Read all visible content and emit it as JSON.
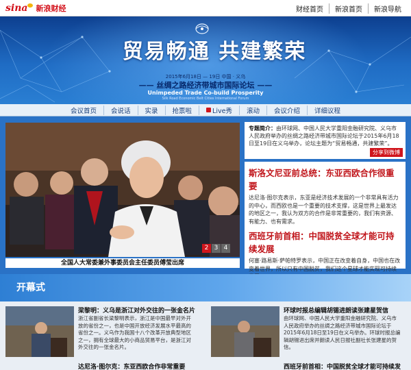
{
  "topbar": {
    "logo_sina": "sina",
    "logo_finance": "新浪财经",
    "links": [
      "财经首页",
      "新浪首页",
      "新浪导航"
    ]
  },
  "banner": {
    "title": "贸易畅通 共建繁荣",
    "date": "2015年6月18日 — 19日  中国 · 义乌",
    "forum_cn": "—— 丝绸之路经济带城市国际论坛 ——",
    "en_line1": "Unimpeded Trade  Co-build Prosperity",
    "en_line2": "Silk Road Economic Belt Cities International Forum"
  },
  "nav": {
    "items": [
      "会议首页",
      "会说话",
      "实录",
      "抢票啦",
      "Live秀",
      "滚动",
      "会议介绍",
      "详细议程"
    ]
  },
  "feature": {
    "caption": "全国人大常委兼外事委员会主任委员傅莹出席",
    "pages": [
      "2",
      "3",
      "4"
    ]
  },
  "intro": {
    "label": "专题简介：",
    "text": "由环球网、中国人民大学重阳金融研究院、义乌市人民政府举办的丝绸之路经济带城市国际论坛于2015年6月18日至19日在义乌举办，论坛主题为“贸易畅通，共建繁荣”。",
    "share": "分享到微博"
  },
  "news": [
    {
      "title": "斯洛文尼亚前总统：东亚西欧合作很重要",
      "text": "达尼洛·图尔克表示，东亚是经济技术发展的一个非常具有活力的中心，而西欧也是一个重要的技术支撑，这是世界上最发达的地区之一，我认为双方的合作是非常重要的，我们有资源、有能力、也有需求。"
    },
    {
      "title": "西班牙前首相：中国脱贫全球才能可持续发展",
      "text": "何塞·路易斯·萨帕特罗表示，中国正在改变着自身，中国也在改变着世界，所以只有中国脱贫，我们这个星球才能实现可持续发展。"
    }
  ],
  "section": {
    "title": "开幕式"
  },
  "cards": [
    {
      "title": "梁黎明：义乌是浙江对外交往的一张金名片",
      "text": "浙江省副省长梁黎明表示，浙江是中国最早对外开放的省份之一，也是中国开放经济发展水平最高的省份之一。义乌作为我国十八个改革开放典型地区之一，拥有全球最大的小商品贸易平台，是浙江对外交往的一张金名片。",
      "more": "达尼洛·图尔克：东亚西欧合作非常重要"
    },
    {
      "title": "环球时报总编辑胡锡进朗读张建星贺信",
      "text": "由环球网、中国人民大学重阳金融研究院、义乌市人民政府举办的丝绸之路经济带城市国际论坛于2015年6月18日至19日在义乌举办。环球时报总编辑胡锡进出席并朗读人民日报社副社长张建星的贺信。",
      "more": "西班牙前首相：中国脱贫全球才能可持续发展"
    }
  ],
  "colors": {
    "brand_red": "#d3111a",
    "banner_blue": "#1f6cc4",
    "headline_red": "#c0141a"
  }
}
